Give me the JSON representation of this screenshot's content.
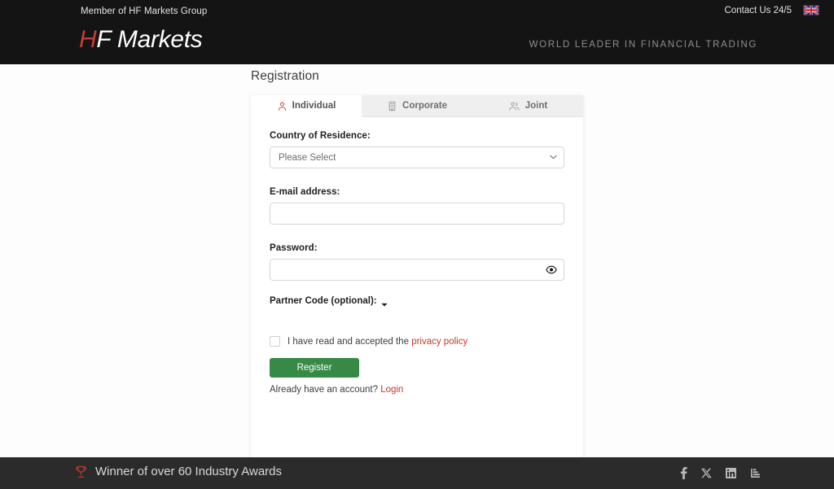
{
  "header": {
    "member_text": "Member of HF Markets Group",
    "contact_label": "Contact Us 24/5",
    "flag_icon": "uk-flag-icon",
    "logo_accent": "H",
    "logo_rest": "F Markets",
    "tagline": "WORLD LEADER IN FINANCIAL TRADING",
    "bg_color": "#141414",
    "accent_color": "#c63b36"
  },
  "main": {
    "page_title": "Registration",
    "tabs": [
      {
        "label": "Individual",
        "icon": "person-icon",
        "active": true
      },
      {
        "label": "Corporate",
        "icon": "building-icon",
        "active": false
      },
      {
        "label": "Joint",
        "icon": "people-icon",
        "active": false
      }
    ],
    "form": {
      "country_label": "Country of Residence:",
      "country_value": "Please Select",
      "email_label": "E-mail address:",
      "email_value": "",
      "email_placeholder": "",
      "password_label": "Password:",
      "password_value": "",
      "password_placeholder": "",
      "password_toggle_icon": "eye-icon",
      "partner_label": "Partner Code (optional):",
      "partner_caret_icon": "caret-down-icon",
      "consent_text": "I have read and accepted the",
      "consent_link": "privacy policy",
      "register_label": "Register",
      "have_account_text": "Already have an account?",
      "login_link": "Login",
      "button_color": "#368a46",
      "link_color": "#c0392b"
    }
  },
  "footer": {
    "award_icon": "trophy-icon",
    "award_text": "Winner of over 60 Industry Awards",
    "bg_color": "#2b2b2b",
    "social": [
      {
        "name": "facebook-icon"
      },
      {
        "name": "x-twitter-icon"
      },
      {
        "name": "linkedin-icon"
      },
      {
        "name": "chart-bars-icon"
      }
    ]
  }
}
